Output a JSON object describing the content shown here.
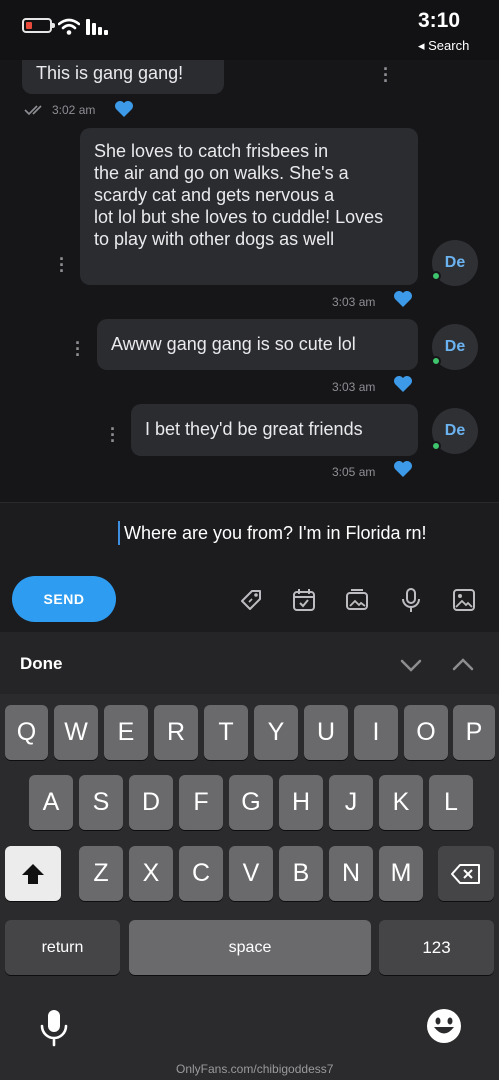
{
  "status_bar": {
    "time": "3:10",
    "back_label": "◂ Search",
    "signal_icon": "signal-bars-icon",
    "wifi_icon": "wifi-icon",
    "battery_icon": "battery-low-icon"
  },
  "messages": [
    {
      "text": "This is gang gang!",
      "time": "3:02 am",
      "from": "self",
      "liked": true
    },
    {
      "text": "She loves to catch frisbees in\nthe air and go on walks. She's a\nscardy cat and gets nervous a\nlot lol but she loves to cuddle! Loves\nto play with other dogs as well",
      "time": "3:03 am",
      "from": "other",
      "avatar": "De",
      "liked": true
    },
    {
      "text": "Awww gang gang is so cute lol",
      "time": "3:03 am",
      "from": "other",
      "avatar": "De",
      "liked": true
    },
    {
      "text": "I bet they'd be great friends",
      "time": "3:05 am",
      "from": "other",
      "avatar": "De",
      "liked": true
    }
  ],
  "composer": {
    "input_value": "Where are you from? I'm in Florida rn!",
    "send_label": "SEND",
    "tools": [
      "image-icon",
      "microphone-icon",
      "media-icon",
      "calendar-icon",
      "price-tag-icon"
    ]
  },
  "keyboard": {
    "done_label": "Done",
    "row1": [
      "Q",
      "W",
      "E",
      "R",
      "T",
      "Y",
      "U",
      "I",
      "O",
      "P"
    ],
    "row2": [
      "A",
      "S",
      "D",
      "F",
      "G",
      "H",
      "J",
      "K",
      "L"
    ],
    "row3": [
      "Z",
      "X",
      "C",
      "V",
      "B",
      "N",
      "M"
    ],
    "numbers_label": "123",
    "space_label": "space",
    "return_label": "return"
  },
  "watermark": "OnlyFans.com/chibigoddess7",
  "colors": {
    "accent": "#2e9df1",
    "online": "#3ec46d",
    "bubble": "#2b2c30",
    "background": "#161618"
  }
}
